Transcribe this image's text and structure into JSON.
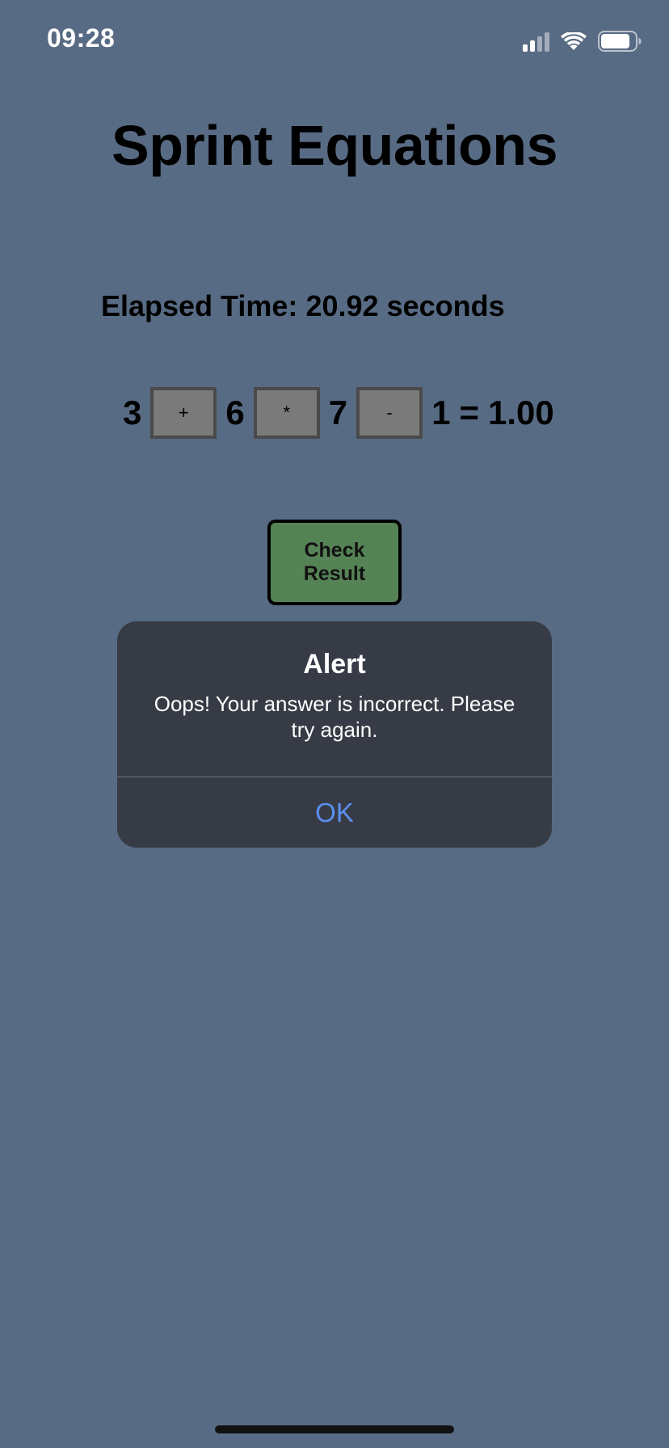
{
  "status_bar": {
    "time": "09:28",
    "icons": [
      "signal-icon",
      "wifi-icon",
      "battery-icon"
    ],
    "signal_bars_active": 2,
    "signal_bars_total": 4
  },
  "app": {
    "title": "Sprint Equations",
    "elapsed_label": "Elapsed Time: ",
    "elapsed_value": "20.92",
    "elapsed_unit": " seconds"
  },
  "equation": {
    "numbers": [
      "3",
      "6",
      "7",
      "1"
    ],
    "operators": [
      "+",
      "*",
      "-"
    ],
    "equals_sign": "=",
    "result": "1.00"
  },
  "check_button": {
    "line1": "Check",
    "line2": "Result"
  },
  "alert": {
    "title": "Alert",
    "message": "Oops! Your answer is incorrect. Please try again.",
    "ok_label": "OK"
  },
  "colors": {
    "background": "#586b84",
    "button_green": "#568356",
    "alert_bg": "#363b45",
    "alert_action": "#5b8fef"
  }
}
